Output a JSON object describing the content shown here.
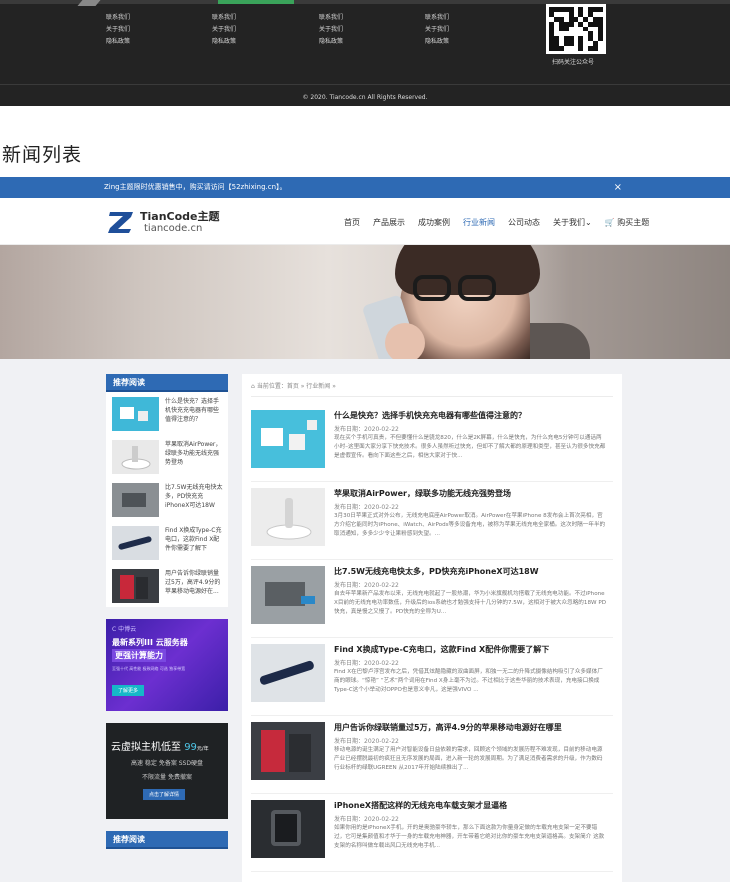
{
  "footer": {
    "columns": [
      [
        "联系我们",
        "关于我们",
        "隐私政策"
      ],
      [
        "联系我们",
        "关于我们",
        "隐私政策"
      ],
      [
        "联系我们",
        "关于我们",
        "隐私政策"
      ],
      [
        "联系我们",
        "关于我们",
        "隐私政策"
      ]
    ],
    "qr_caption": "扫码关注公众号",
    "copyright": "© 2020. Tiancode.cn All Rights Reserved."
  },
  "section_title": "新闻列表",
  "notice": {
    "text": "Zing主题限时优惠销售中，购买请访问【52zhixing.cn】。",
    "close": "×"
  },
  "header": {
    "logo_title": "TianCode主题",
    "logo_sub": "tiancode.cn",
    "nav": [
      "首页",
      "产品展示",
      "成功案例",
      "行业新闻",
      "公司动态",
      "关于我们⌄",
      "🛒 购买主题"
    ],
    "active_index": 3
  },
  "sidebar": {
    "widget_title": "推荐阅读",
    "items": [
      "什么是快充？选择手机快充充电器有哪些值得注意的？",
      "苹果取消AirPower，绿联多功能无线充强势登场",
      "比7.5W无线充电快太多，PD快充充iPhoneX可达18W",
      "Find X换成Type-C充电口，这款Find X配件你需要了解下",
      "用户告诉你绿联销量过5万，高评4.9分的苹果移动电源好在..."
    ],
    "ad1": {
      "brand": "C 中博云",
      "line1": "最新系列III 云服务器",
      "line2": "更强计算能力",
      "line3": "至强十代 高性能 极致网络 可选 独享带宽",
      "button": "了解更多"
    },
    "ad2": {
      "line1_prefix": "云虚拟主机低至",
      "price": "99",
      "unit": "元/年",
      "line2": "高速 稳定 免备案 SSD硬盘",
      "line3": "不限流量 免费撤案",
      "button": "点击了解详情"
    },
    "widget2_title": "推荐阅读"
  },
  "main": {
    "crumbs": "当前位置：首页 » 行业新闻 »",
    "articles": [
      {
        "title": "什么是快充？选择手机快充充电器有哪些值得注意的？",
        "date": "发布日期：2020-02-22",
        "summary": "现在买个手机可真贵，不但要懂什么是骁龙820，什么是2K屏幕，什么是快充，为什么充电5分钟可以通话两小时–这里面大家分享下快充技术。很多人虽然听过快充，但却不了解大都的原理和类型，甚至认为很多快充都是虚假宣传。看向下面这些之后，相信大家对于快..."
      },
      {
        "title": "苹果取消AirPower，绿联多功能无线充强势登场",
        "date": "发布日期：2020-02-22",
        "summary": "3月30日苹果正式对外公布，无线充电底座AirPower取消。AirPower在苹果iPhone 8发布会上首次亮相，官方介绍它能同时为iPhone、iWatch、AirPods等多设备充电，被称为苹果无线充电全家桶。这次时隔一年半的取消通知，多多少少令让果粉感到失望。..."
      },
      {
        "title": "比7.5W无线充电快太多，PD快充充iPhoneX可达18W",
        "date": "发布日期：2020-02-22",
        "summary": "自去年苹果新产品发布以来，无线充电就起了一股热潮，华为小米旗舰机均搭载了无线充电功能。不过iPhone X目前的无线充电功率数低，升级后的ios系统也才勉强支持十几分钟的7.5W，这相对于被大众忽略的18W PD快充，真是慢之又慢了。PD快充的全称为U..."
      },
      {
        "title": "Find X换成Type-C充电口，这款Find X配件你需要了解下",
        "date": "发布日期：2020-02-22",
        "summary": "Find X在巴黎卢浮宫发布之后，凭借其炫酷隐藏的双曲面屏，和独一无二的升降式摄像结构吸引了众多媒体厂商的眼球。“惊艳” “艺术”两个词用在Find X身上毫不为过。不过相比于这些华丽的技术表现，充电接口换成Type-C这个小举动对OPPO也是意义非凡，这是强VIVO ..."
      },
      {
        "title": "用户告诉你绿联销量过5万，高评4.9分的苹果移动电源好在哪里",
        "date": "发布日期：2020-02-22",
        "summary": "移动电源的诞生满足了用户对智能设备日益依赖的需求，回顾这个领域的发展历程不难发现，目前的移动电源产业已经摆脱最初的疯狂且无序发展的局面，进入新一轮的发展周期。为了满足消费者需求的升级，作为数码行业标杆的绿联UGREEN 从2017年开始陆续推出了..."
      },
      {
        "title": "iPhoneX搭配这样的无线充电车载支架才显逼格",
        "date": "发布日期：2020-02-22",
        "summary": "如果你用的是iPhoneX手机，开的是奥驰豪华轿车，那么下面这款为你量身定做的车载充电支架一定不要错过，它可是集颜值和才华于一身的车载充电神器，开车带着它绝对比你的豪车充电支架逼格高。支架简介 这款支架的名称叫做车载出风口无线充电手机..."
      }
    ]
  }
}
